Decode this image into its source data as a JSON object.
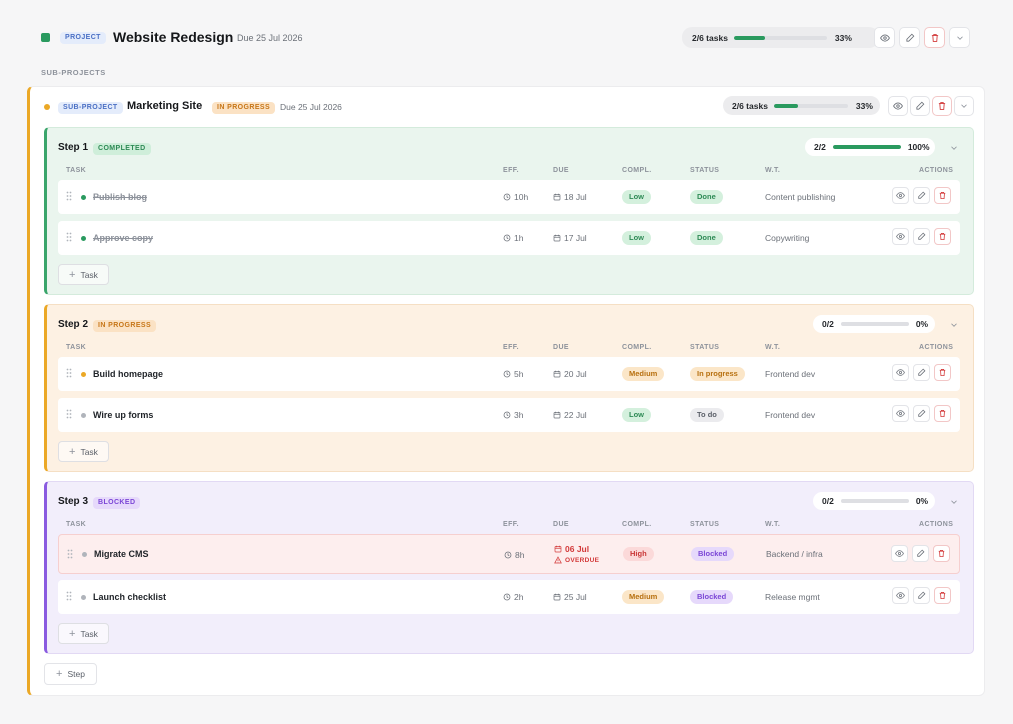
{
  "project": {
    "badge": "PROJECT",
    "title": "Website Redesign",
    "due": "Due 25 Jul 2026",
    "tasks": "2/6 tasks",
    "progress": 33,
    "progress_label": "33%",
    "color": "#2a9a5f"
  },
  "sub_projects_label": "SUB-PROJECTS",
  "sub_project": {
    "badge": "SUB-PROJECT",
    "title": "Marketing Site",
    "status": "IN PROGRESS",
    "due": "Due 25 Jul 2026",
    "tasks": "2/6 tasks",
    "progress": 33,
    "progress_label": "33%",
    "accent": "#eba826"
  },
  "columns": {
    "task": "TASK",
    "eff": "EFF.",
    "due": "DUE",
    "compl": "COMPL.",
    "status": "STATUS",
    "wt": "W.T.",
    "actions": "ACTIONS"
  },
  "steps": [
    {
      "name": "Step 1",
      "status": "COMPLETED",
      "count": "2/2",
      "progress": 100,
      "progress_label": "100%",
      "tasks": [
        {
          "name": "Publish blog",
          "effort": "10h",
          "due": "18 Jul",
          "complexity": "Low",
          "status": "Done",
          "work_type": "Content publishing"
        },
        {
          "name": "Approve copy",
          "effort": "1h",
          "due": "17 Jul",
          "complexity": "Low",
          "status": "Done",
          "work_type": "Copywriting"
        }
      ],
      "add_label": "Task"
    },
    {
      "name": "Step 2",
      "status": "IN PROGRESS",
      "count": "0/2",
      "progress": 0,
      "progress_label": "0%",
      "tasks": [
        {
          "name": "Build homepage",
          "effort": "5h",
          "due": "20 Jul",
          "complexity": "Medium",
          "status": "In progress",
          "work_type": "Frontend dev"
        },
        {
          "name": "Wire up forms",
          "effort": "3h",
          "due": "22 Jul",
          "complexity": "Low",
          "status": "To do",
          "work_type": "Frontend dev"
        }
      ],
      "add_label": "Task"
    },
    {
      "name": "Step 3",
      "status": "BLOCKED",
      "count": "0/2",
      "progress": 0,
      "progress_label": "0%",
      "tasks": [
        {
          "name": "Migrate CMS",
          "effort": "8h",
          "due": "06 Jul",
          "overdue": "OVERDUE",
          "complexity": "High",
          "status": "Blocked",
          "work_type": "Backend / infra"
        },
        {
          "name": "Launch checklist",
          "effort": "2h",
          "due": "25 Jul",
          "complexity": "Medium",
          "status": "Blocked",
          "work_type": "Release mgmt"
        }
      ],
      "add_label": "Task"
    }
  ],
  "add_step_label": "Step"
}
